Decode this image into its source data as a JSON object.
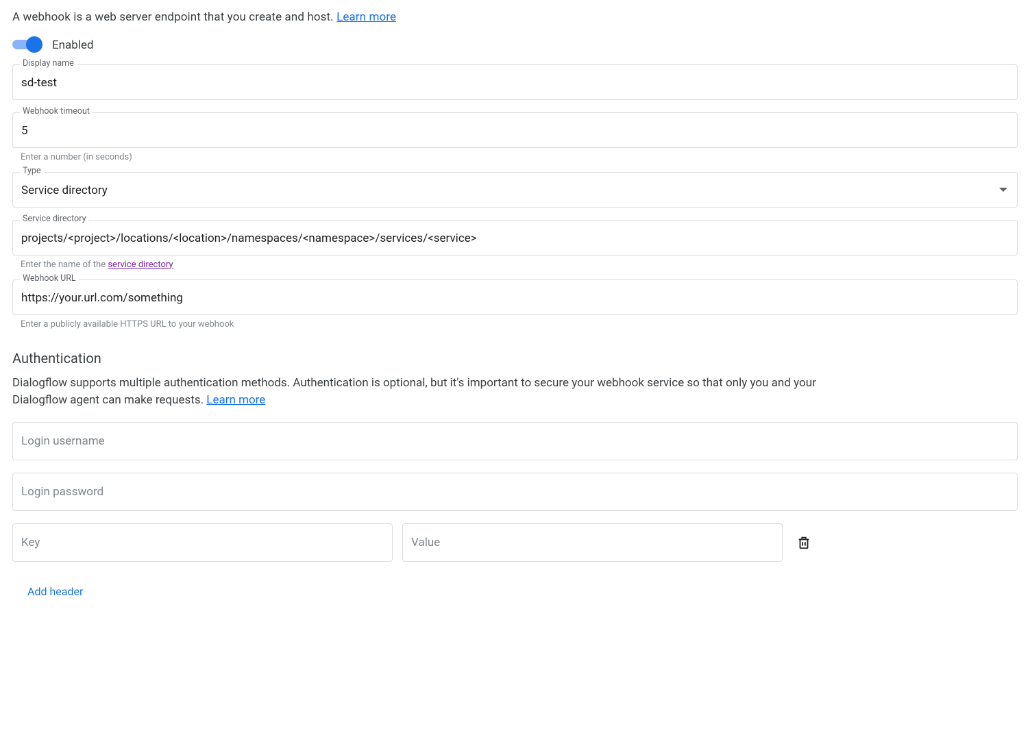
{
  "intro": {
    "text": "A webhook is a web server endpoint that you create and host. ",
    "learn_more_label": "Learn more"
  },
  "toggle": {
    "enabled": true,
    "label": "Enabled"
  },
  "fields": {
    "display_name": {
      "label": "Display name",
      "value": "sd-test"
    },
    "timeout": {
      "label": "Webhook timeout",
      "value": "5",
      "helper": "Enter a number (in seconds)"
    },
    "type": {
      "label": "Type",
      "value": "Service directory"
    },
    "service_directory": {
      "label": "Service directory",
      "value": "projects/<project>/locations/<location>/namespaces/<namespace>/services/<service>",
      "helper_prefix": "Enter the name of the ",
      "helper_link": "service directory"
    },
    "webhook_url": {
      "label": "Webhook URL",
      "value": "https://your.url.com/something",
      "helper": "Enter a publicly available HTTPS URL to your webhook"
    }
  },
  "auth": {
    "heading": "Authentication",
    "desc_text": "Dialogflow supports multiple authentication methods. Authentication is optional, but it's important to secure your webhook service so that only you and your Dialogflow agent can make requests. ",
    "learn_more_label": "Learn more",
    "login_username_placeholder": "Login username",
    "login_password_placeholder": "Login password",
    "header_key_placeholder": "Key",
    "header_value_placeholder": "Value",
    "add_header_label": "Add header"
  }
}
